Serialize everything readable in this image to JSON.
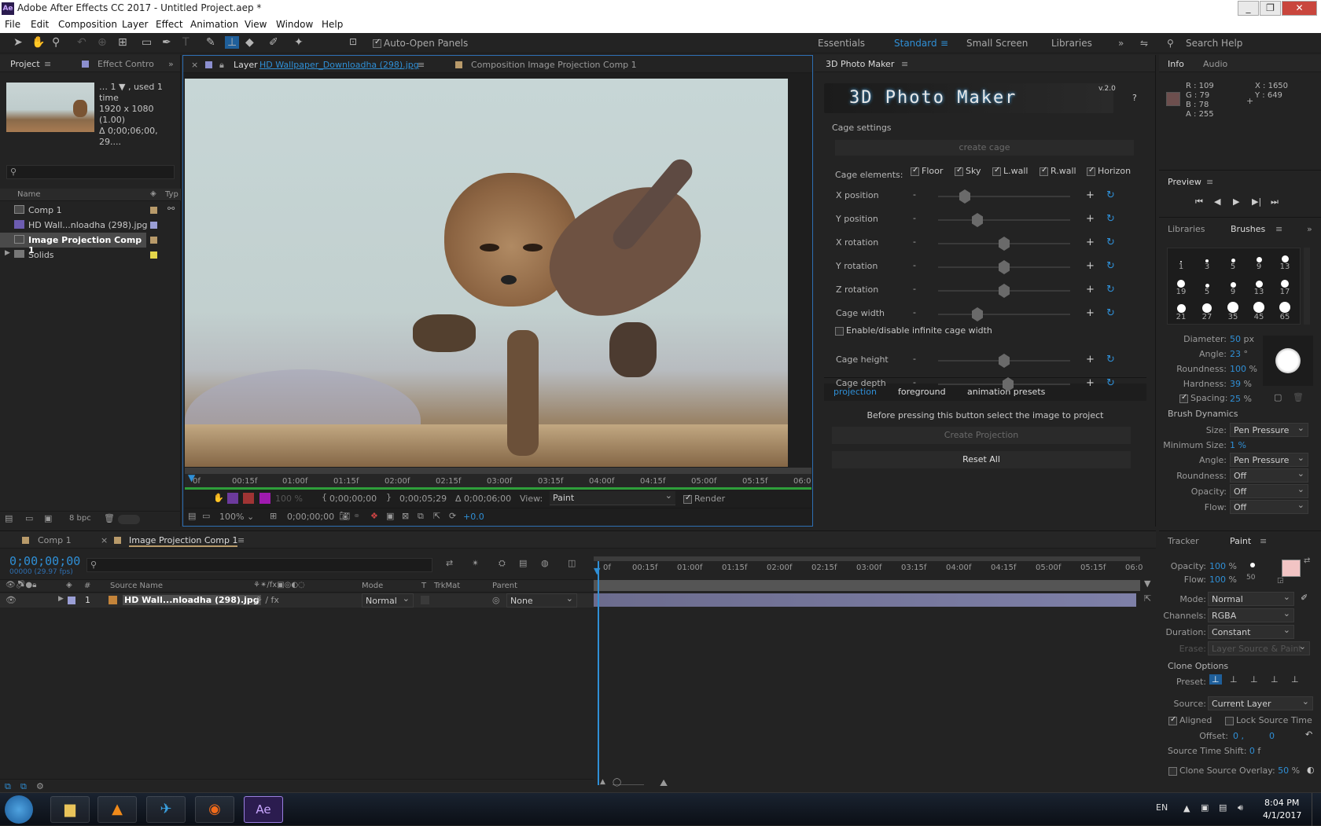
{
  "title": {
    "app_icon": "Ae",
    "text": "Adobe After Effects CC 2017 - Untitled Project.aep *"
  },
  "menu": [
    "File",
    "Edit",
    "Composition",
    "Layer",
    "Effect",
    "Animation",
    "View",
    "Window",
    "Help"
  ],
  "toolbar": {
    "auto_open": "Auto-Open Panels",
    "workspaces": [
      "Essentials",
      "Standard",
      "Small Screen",
      "Libraries"
    ],
    "search": "Search Help"
  },
  "project": {
    "tab": "Project",
    "tab2": "Effect Contro",
    "info1": "… 1 ▼ , used 1 time",
    "info2": "1920 x 1080 (1.00)",
    "info3": "Δ 0;00;06;00, 29....",
    "col_name": "Name",
    "col_type": "Typ",
    "items": [
      "Comp 1",
      "HD Wall...nloadha (298).jpg",
      "Image Projection Comp 1",
      "Solids"
    ],
    "bpc": "8 bpc"
  },
  "viewer": {
    "tab_layer_prefix": "Layer",
    "tab_layer_name": "HD Wallpaper_Downloadha (298).jpg",
    "tab_comp": "Composition Image Projection Comp 1",
    "ruler": [
      "0f",
      "00:15f",
      "01:00f",
      "01:15f",
      "02:00f",
      "02:15f",
      "03:00f",
      "03:15f",
      "04:00f",
      "04:15f",
      "05:00f",
      "05:15f",
      "06:0"
    ],
    "in_time": "0;00;00;00",
    "out_time": "0;00;05;29",
    "dur": "Δ 0;00;06;00",
    "view_label": "View:",
    "view_value": "Paint",
    "render": "Render",
    "zoom": "100%",
    "cur_time": "0;00;00;00",
    "exposure": "+0.0",
    "opacity": "100 %"
  },
  "pm": {
    "panel": "3D Photo Maker",
    "logo": "3D Photo Maker",
    "version": "v.2.0",
    "help": "?",
    "cage_settings": "Cage settings",
    "create_cage": "create cage",
    "cage_elements": "Cage elements:",
    "elements": [
      "Floor",
      "Sky",
      "L.wall",
      "R.wall",
      "Horizon"
    ],
    "sliders": [
      {
        "label": "X position",
        "value": 0.2
      },
      {
        "label": "Y position",
        "value": 0.3
      },
      {
        "label": "X rotation",
        "value": 0.5
      },
      {
        "label": "Y rotation",
        "value": 0.5
      },
      {
        "label": "Z rotation",
        "value": 0.5
      },
      {
        "label": "Cage width",
        "value": 0.3
      }
    ],
    "infinite": "Enable/disable infinite cage width",
    "sliders2": [
      {
        "label": "Cage height",
        "value": 0.5
      },
      {
        "label": "Cage depth",
        "value": 0.53
      }
    ],
    "tabs": [
      "projection",
      "foreground",
      "animation presets"
    ],
    "note": "Before pressing this button select the image to project",
    "create_proj": "Create Projection",
    "reset": "Reset All"
  },
  "info": {
    "tab": "Info",
    "tab2": "Audio",
    "r": "R : 109",
    "g": "G : 79",
    "b": "B : 78",
    "a": "A : 255",
    "x": "X : 1650",
    "y": "Y : 649",
    "swatch": "#6d4f4e"
  },
  "preview": {
    "tab": "Preview"
  },
  "brushes": {
    "tab1": "Libraries",
    "tab2": "Brushes",
    "sizes": [
      "1",
      "3",
      "5",
      "9",
      "13",
      "19",
      "5",
      "9",
      "13",
      "17",
      "21",
      "27",
      "35",
      "45",
      "65"
    ],
    "diameter_l": "Diameter:",
    "diameter": "50",
    "diameter_u": "px",
    "angle_l": "Angle:",
    "angle": "23",
    "angle_u": "°",
    "round_l": "Roundness:",
    "round": "100",
    "round_u": "%",
    "hard_l": "Hardness:",
    "hard": "39",
    "hard_u": "%",
    "spacing_l": "Spacing:",
    "spacing": "25",
    "spacing_u": "%",
    "dynamics": "Brush Dynamics",
    "dyn": [
      {
        "l": "Size:",
        "v": "Pen Pressure"
      },
      {
        "l": "Minimum Size:",
        "v": "1 %"
      },
      {
        "l": "Angle:",
        "v": "Pen Pressure"
      },
      {
        "l": "Roundness:",
        "v": "Off"
      },
      {
        "l": "Opacity:",
        "v": "Off"
      },
      {
        "l": "Flow:",
        "v": "Off"
      }
    ]
  },
  "timeline": {
    "tab1": "Comp 1",
    "tab2": "Image Projection Comp 1",
    "timecode": "0;00;00;00",
    "fps": "00000 (29.97 fps)",
    "cols": {
      "num": "#",
      "src": "Source Name",
      "mode": "Mode",
      "t": "T",
      "trkmat": "TrkMat",
      "parent": "Parent"
    },
    "layer": {
      "num": "1",
      "name": "HD Wall...nloadha (298).jpg",
      "mode": "Normal",
      "parent": "None"
    },
    "ruler": [
      "0f",
      "00:15f",
      "01:00f",
      "01:15f",
      "02:00f",
      "02:15f",
      "03:00f",
      "03:15f",
      "04:00f",
      "04:15f",
      "05:00f",
      "05:15f",
      "06:0"
    ]
  },
  "paint": {
    "tab1": "Tracker",
    "tab2": "Paint",
    "opacity_l": "Opacity:",
    "opacity": "100",
    "flow_l": "Flow:",
    "flow": "100",
    "pct": "%",
    "brush_size": "50",
    "mode_l": "Mode:",
    "mode": "Normal",
    "channels_l": "Channels:",
    "channels": "RGBA",
    "duration_l": "Duration:",
    "duration": "Constant",
    "erase_l": "Erase:",
    "erase": "Layer Source & Paint",
    "clone": "Clone Options",
    "preset_l": "Preset:",
    "source_l": "Source:",
    "source": "Current Layer",
    "aligned": "Aligned",
    "lock": "Lock Source Time",
    "offset_l": "Offset:",
    "offset": "0 ,",
    "offset2": "0",
    "shift_l": "Source Time Shift:",
    "shift": "0",
    "shift_u": "f",
    "overlay_l": "Clone Source Overlay:",
    "overlay": "50",
    "fg": "#f2c4c4"
  },
  "taskbar": {
    "lang": "EN",
    "time": "8:04 PM",
    "date": "4/1/2017"
  }
}
